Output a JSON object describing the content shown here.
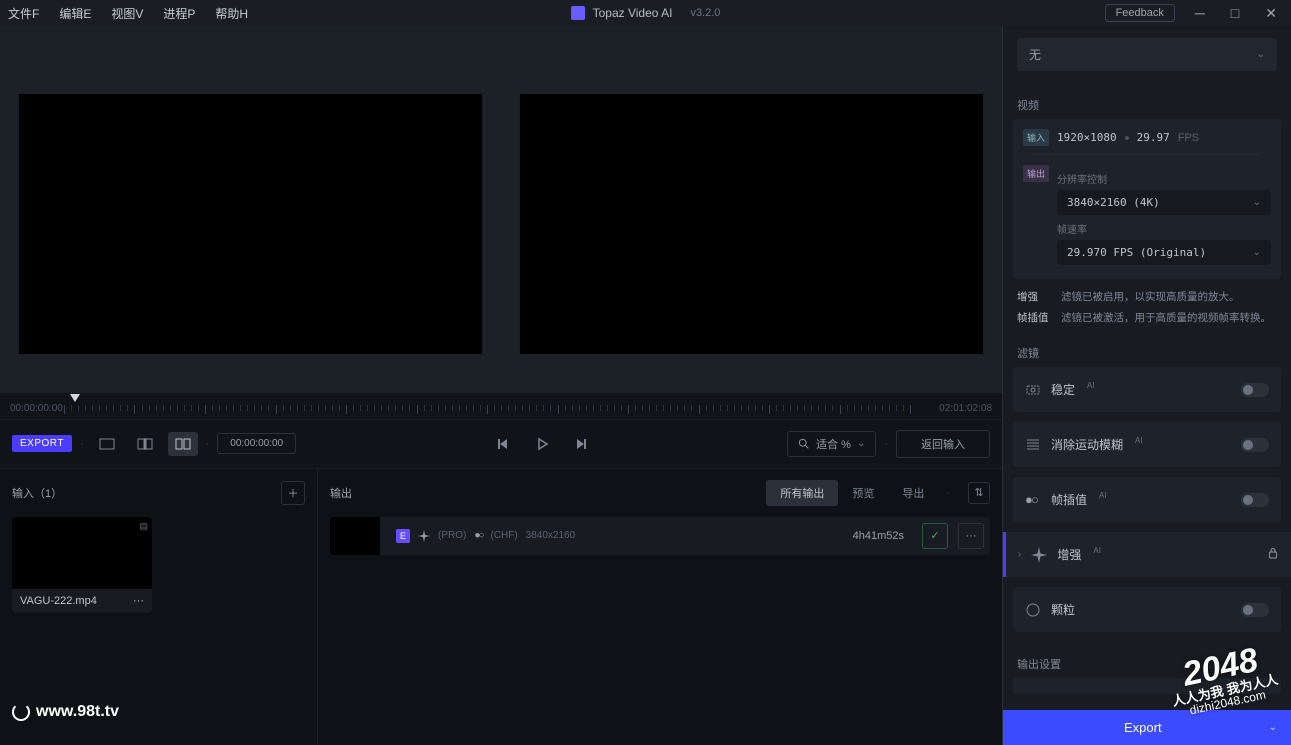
{
  "menu": {
    "file": "文件F",
    "edit": "编辑E",
    "view": "视图V",
    "process": "进程P",
    "help": "帮助H"
  },
  "app": {
    "name": "Topaz Video AI",
    "version": "v3.2.0",
    "feedback": "Feedback"
  },
  "timeline": {
    "start": "00:00:00:00",
    "end": "02:01:02:08"
  },
  "controls": {
    "export": "EXPORT",
    "timecode": "00:00:00:00",
    "zoom": "适合 %",
    "back": "返回输入"
  },
  "inputs": {
    "title": "输入（1）",
    "file": "VAGU-222.mp4",
    "more": "···"
  },
  "outputs": {
    "title": "输出",
    "tabs": {
      "all": "所有输出",
      "preview": "预览",
      "export": "导出"
    },
    "row": {
      "chip": "E",
      "pro": "(PRO)",
      "chf": "(CHF)",
      "res": "3840x2160",
      "dur": "4h41m52s",
      "check": "✓",
      "more": "···"
    },
    "dot": "·",
    "sort": "⇅"
  },
  "right": {
    "top_dd": "无",
    "sec_video": "视频",
    "input_tag": "输入",
    "input_res": "1920×1080",
    "input_fps": "29.97",
    "fps_unit": "FPS",
    "output_tag": "输出",
    "res_label": "分辨率控制",
    "out_res": "3840×2160 (4K)",
    "fps_label": "帧速率",
    "out_fps": "29.970 FPS (Original)",
    "enhance_key": "增强",
    "enhance_note": "滤镜已被启用，以实现高质量的放大。",
    "interp_key": "帧插值",
    "interp_note": "滤镜已被激活，用于高质量的视频帧率转换。",
    "sec_filter": "滤镜",
    "stabilize": "稳定",
    "deblur": "消除运动模糊",
    "interp": "帧插值",
    "enhance": "增强",
    "grain": "颗粒",
    "ai": "AI",
    "sec_out": "输出设置",
    "export": "Export"
  },
  "wm": {
    "site": "www.98t.tv",
    "big": "2048",
    "line": "人人为我 我为人人",
    "url": "dizhi2048.com"
  }
}
